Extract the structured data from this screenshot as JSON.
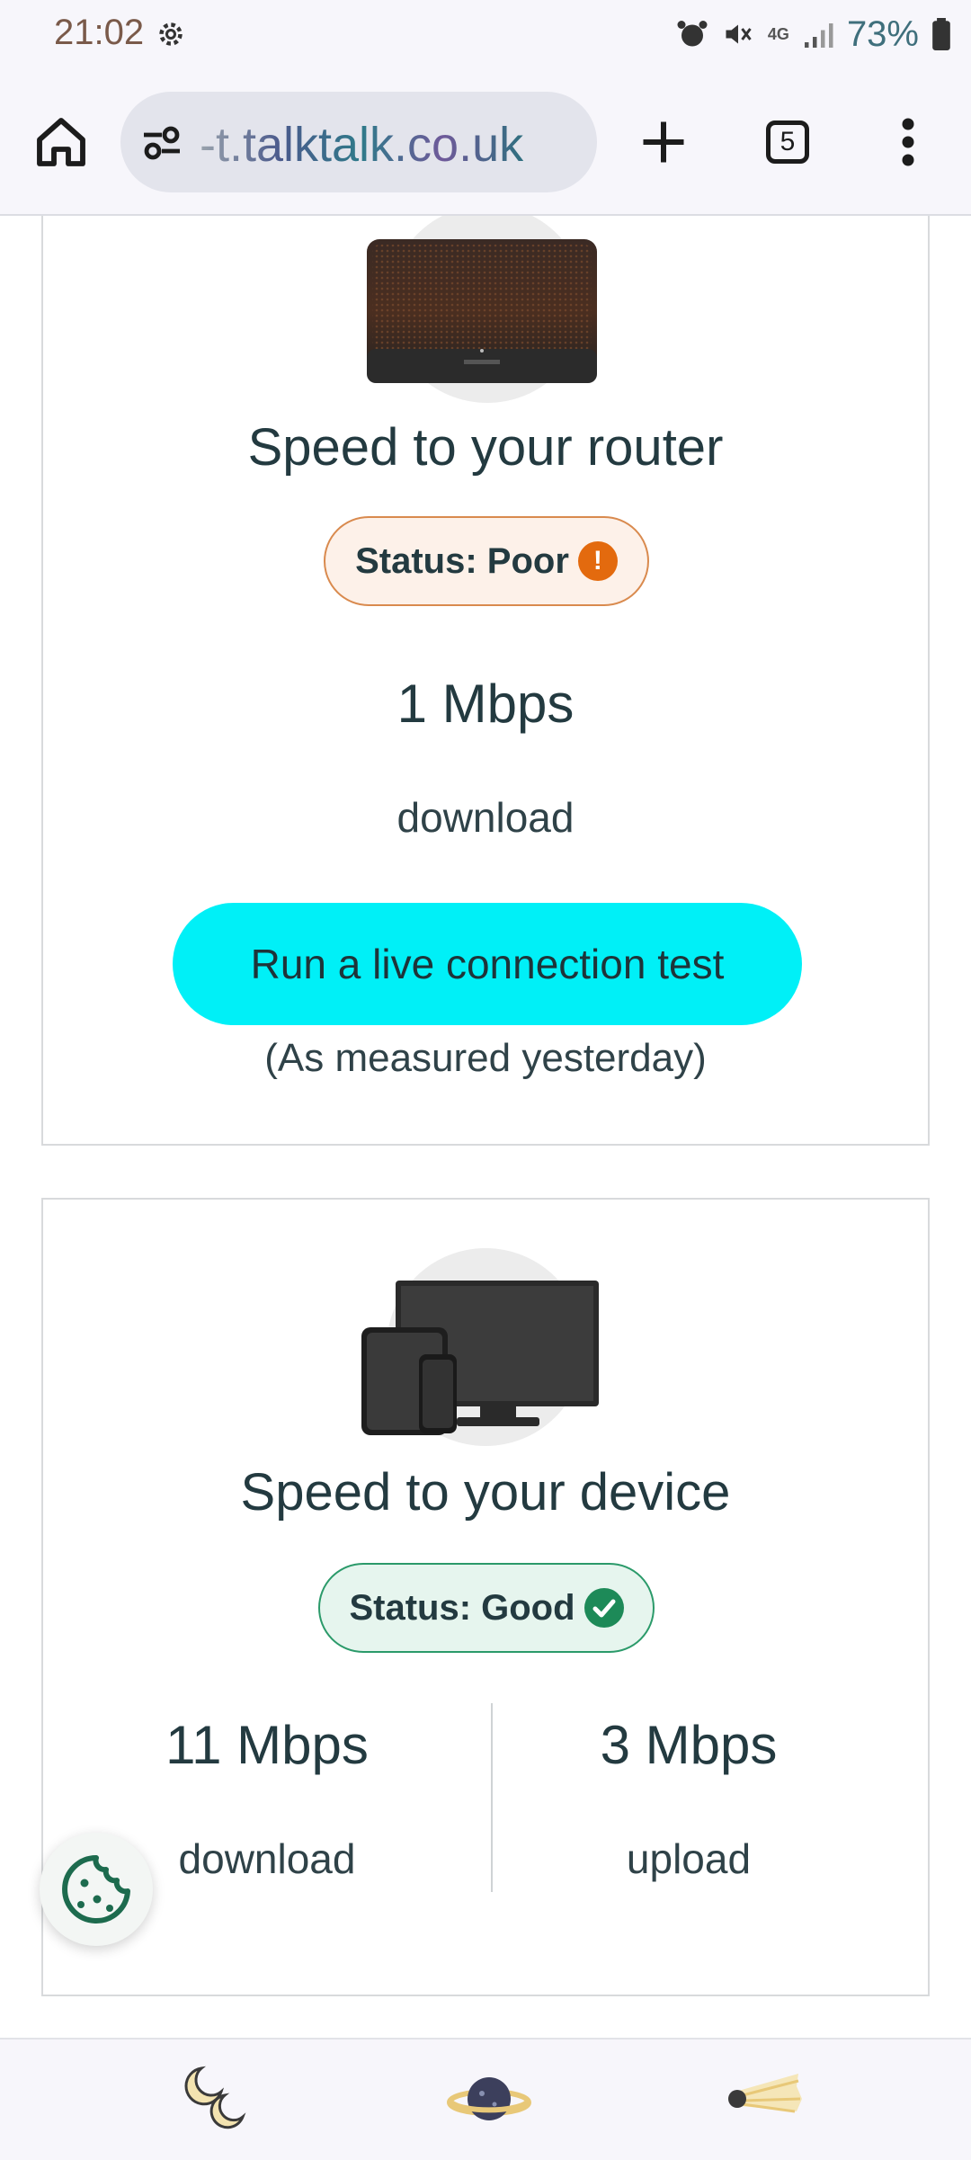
{
  "status_bar": {
    "time": "21:02",
    "network": "4G",
    "battery": "73%"
  },
  "browser": {
    "url": "-t.talktalk.co.uk",
    "tab_count": "5"
  },
  "router_card": {
    "title": "Speed to your router",
    "status": "Status: Poor",
    "status_icon": "!",
    "download_value": "1 Mbps",
    "download_label": "download",
    "button": "Run a live connection test",
    "note": "(As measured yesterday)"
  },
  "device_card": {
    "title": "Speed to your device",
    "status": "Status: Good",
    "download_value": "11 Mbps",
    "download_label": "download",
    "upload_value": "3 Mbps",
    "upload_label": "upload"
  },
  "colors": {
    "accent_button": "#00f0f7",
    "poor": "#e36a0e",
    "good": "#1d8a58"
  }
}
